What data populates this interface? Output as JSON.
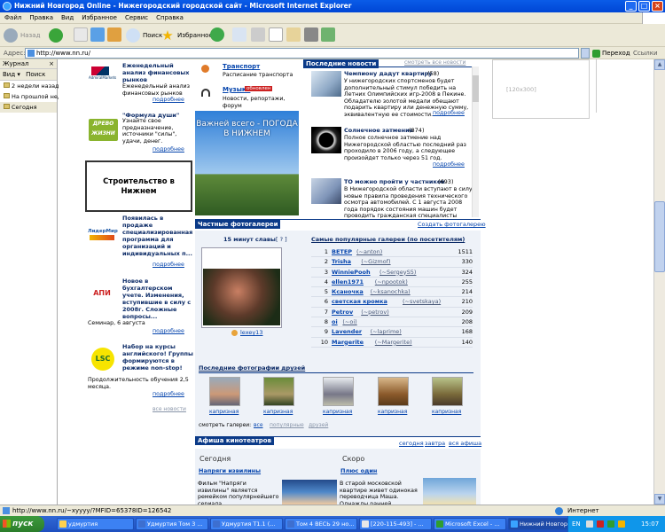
{
  "window": {
    "title": "Нижний Новгород Online - Нижегородский городской сайт - Microsoft Internet Explorer"
  },
  "menu": [
    "Файл",
    "Правка",
    "Вид",
    "Избранное",
    "Сервис",
    "Справка"
  ],
  "toolbar": {
    "back": "Назад",
    "search": "Поиск",
    "favorites": "Избранное"
  },
  "address": {
    "label": "Адрес:",
    "url": "http://www.nn.ru/",
    "go": "Переход",
    "links": "Ссылки"
  },
  "journal": {
    "title": "Журнал",
    "view": "Вид",
    "search": "Поиск",
    "items": [
      "2 недели назад",
      "На прошлой неделе",
      "Сегодня"
    ]
  },
  "left": {
    "b1_title": "Еженедельный анализ финансовых рынков",
    "b1_text": "Еженедельный анализ финансовых рынков",
    "b1_logo": "AdmiralMarkets",
    "b2_title": "\"Формула души\"",
    "b2_text": "Узнайте свое предназначение, источники \"силы\", удачи, денег.",
    "b2_logo": "ДРЕВО ЖИЗНИ",
    "stroy": "Строительство в Нижнем",
    "b3_title": "Появилась в продаже специализированная программа для организаций и индивидуальных п...",
    "b3_logo": "ЛидерМир",
    "b4_title": "Новое в бухгалтерском учете. Изменения, вступившие в силу с 2008г. Сложные вопросы...",
    "b4_text": "Семинар, 6 августа",
    "b4_logo": "АПИ",
    "b5_title": "Набор на курсы английского! Группы формируются в режиме non-stop!",
    "b5_text": "Продолжительность обучения 2,5 месяца.",
    "b5_logo": "LSC",
    "more": "подробнее",
    "all_news": "все новости"
  },
  "mid": {
    "transport": "Транспорт",
    "transport_sub": "Расписание транспорта",
    "music": "Музыка",
    "music_badge": "обновлен",
    "music_sub": "Новости, репортажи, форум",
    "banner": "Важней всего - ПОГОДА В НИЖНЕМ",
    "gal_tab": "Частные фотогалереи",
    "create_gal": "Создать фотогалерею",
    "fame": "15 минут славы",
    "fame_q": "[ ? ]",
    "fame_user": "lexey13",
    "popular": "Самые популярные галереи (по посетителям)",
    "friends": "Последние фотографии друзей",
    "friend_names": [
      "капризная",
      "капризная",
      "капризная",
      "капризная",
      "капризная"
    ],
    "view_gal": "смотреть галереи:",
    "view_all": "все",
    "view_pop": "популярные",
    "view_fr": "друзей",
    "cinema": "Афиша кинотеатров",
    "today_l": "сегодня",
    "tomorrow_l": "завтра",
    "all_afisha": "вся афиша",
    "today": "Сегодня",
    "soon": "Скоро",
    "movie1": "Напряги извилины",
    "movie1_text": "Фильм \"Напряги извилины\" является ремейком популярнейшего сериала",
    "movie2": "Плюс один",
    "movie2_text": "В старой московской квартире живет одинокая переводчица Маша. Однажды ранней"
  },
  "gallery_rank": [
    {
      "n": "1",
      "name": "ВЕТЕР",
      "user": "(~anton)",
      "v": "1511"
    },
    {
      "n": "2",
      "name": "Trisha",
      "user": "(~Gizmof)",
      "v": "330"
    },
    {
      "n": "3",
      "name": "WinniePooh",
      "user": "(~SergeyS5)",
      "v": "324"
    },
    {
      "n": "4",
      "name": "ellen1971",
      "user": "(~npootok)",
      "v": "255"
    },
    {
      "n": "5",
      "name": "Ксаночка",
      "user": "(~ksanochka)",
      "v": "214"
    },
    {
      "n": "6",
      "name": "светская кромка",
      "user": "(~svetskaya)",
      "v": "210"
    },
    {
      "n": "7",
      "name": "Petrov",
      "user": "(~petrov)",
      "v": "209"
    },
    {
      "n": "8",
      "name": "oi",
      "user": "(~oi)",
      "v": "208"
    },
    {
      "n": "9",
      "name": "Lavender",
      "user": "(~laprime)",
      "v": "168"
    },
    {
      "n": "10",
      "name": "Margerite",
      "user": "(~Margerite)",
      "v": "140"
    }
  ],
  "news": {
    "tab": "Последние новости",
    "all": "смотреть все новости",
    "items": [
      {
        "title": "Чемпиону дадут квартиру",
        "count": "(58)",
        "text": "У нижегородских спортсменов будет дополнительный стимул победить на Летних Олимпийских игр-2008 в Пекине. Обладателю золотой медали обещают подарить квартиру или денежную сумму, эквивалентную ее стоимости."
      },
      {
        "title": "Солнечное затмение",
        "count": "(874)",
        "text": "Полное солнечное затмение над Нижегородской областью последний раз проходило в 2006 году, а следующее произойдет только через 51 год."
      },
      {
        "title": "ТО можно пройти у частников",
        "count": "(693)",
        "text": "В Нижегородской области вступают в силу новые правила проведения технического осмотра автомобилей. С 1 августа 2008 года порядок состояния машин будет проводить гражданская специалисты"
      }
    ],
    "more": "подробнее"
  },
  "ad": {
    "size": "[120x300]"
  },
  "status": {
    "url": "http://www.nn.ru/~xyyyy/?MFID=65378ID=126542",
    "zone": "Интернет"
  },
  "taskbar": {
    "start": "пуск",
    "tasks": [
      "удмуртия",
      "Удмуртия Том 3 ...",
      "Удмуртия Т1.1 (...",
      "Том 4 ВЕСЬ 29 но...",
      "[220-115-493] - ...",
      "Microsoft Excel - ...",
      "Нижний Новгоро..."
    ],
    "lang": "EN",
    "time": "15:07"
  }
}
